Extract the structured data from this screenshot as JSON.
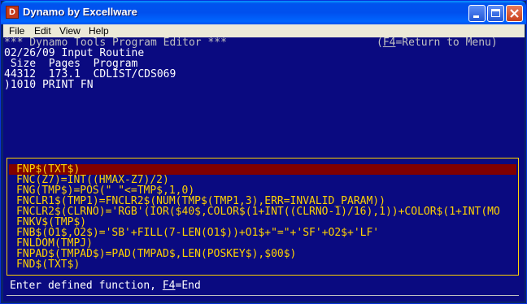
{
  "window": {
    "title": "Dynamo by Excellware",
    "icon": "app-icon"
  },
  "menu": {
    "items": [
      "File",
      "Edit",
      "View",
      "Help"
    ]
  },
  "console": {
    "header_left": "*** Dynamo Tools Program Editor ***",
    "header_right_key": "F4",
    "header_right_rest": "=Return to Menu)",
    "header_right_open": "(",
    "date_line": "02/26/09 Input Routine",
    "columns_line": " Size  Pages  Program",
    "values_line": "44312  173.1  CDLIST/CDS069",
    "prompt_line": ")1010 PRINT FN"
  },
  "functions": {
    "selected_index": 0,
    "items": [
      "FNP$(TXT$)",
      "FNC(Z7)=INT((HMAX-Z7)/2)",
      "FNG(TMP$)=POS(\" \"<=TMP$,1,0)",
      "FNCLR1$(TMP1)=FNCLR2$(NUM(TMP$(TMP1,3),ERR=INVALID_PARAM))",
      "FNCLR2$(CLRNO)='RGB'(IOR($40$,COLOR$(1+INT((CLRNO-1)/16),1))+COLOR$(1+INT(MO",
      "FNKV$(TMP$)",
      "FNB$(O1$,O2$)='SB'+FILL(7-LEN(O1$))+O1$+\"=\"+'SF'+O2$+'LF'",
      "FNLDOM(TMPJ)",
      "FNPAD$(TMPAD$)=PAD(TMPAD$,LEN(POSKEY$),$00$)",
      "FND$(TXT$)"
    ]
  },
  "status": {
    "prefix": "Enter defined function, ",
    "key": "F4",
    "suffix": "=End"
  },
  "colors": {
    "console_bg": "#0a0a80",
    "highlight": "#ffd200",
    "selected_bg": "#800000"
  }
}
